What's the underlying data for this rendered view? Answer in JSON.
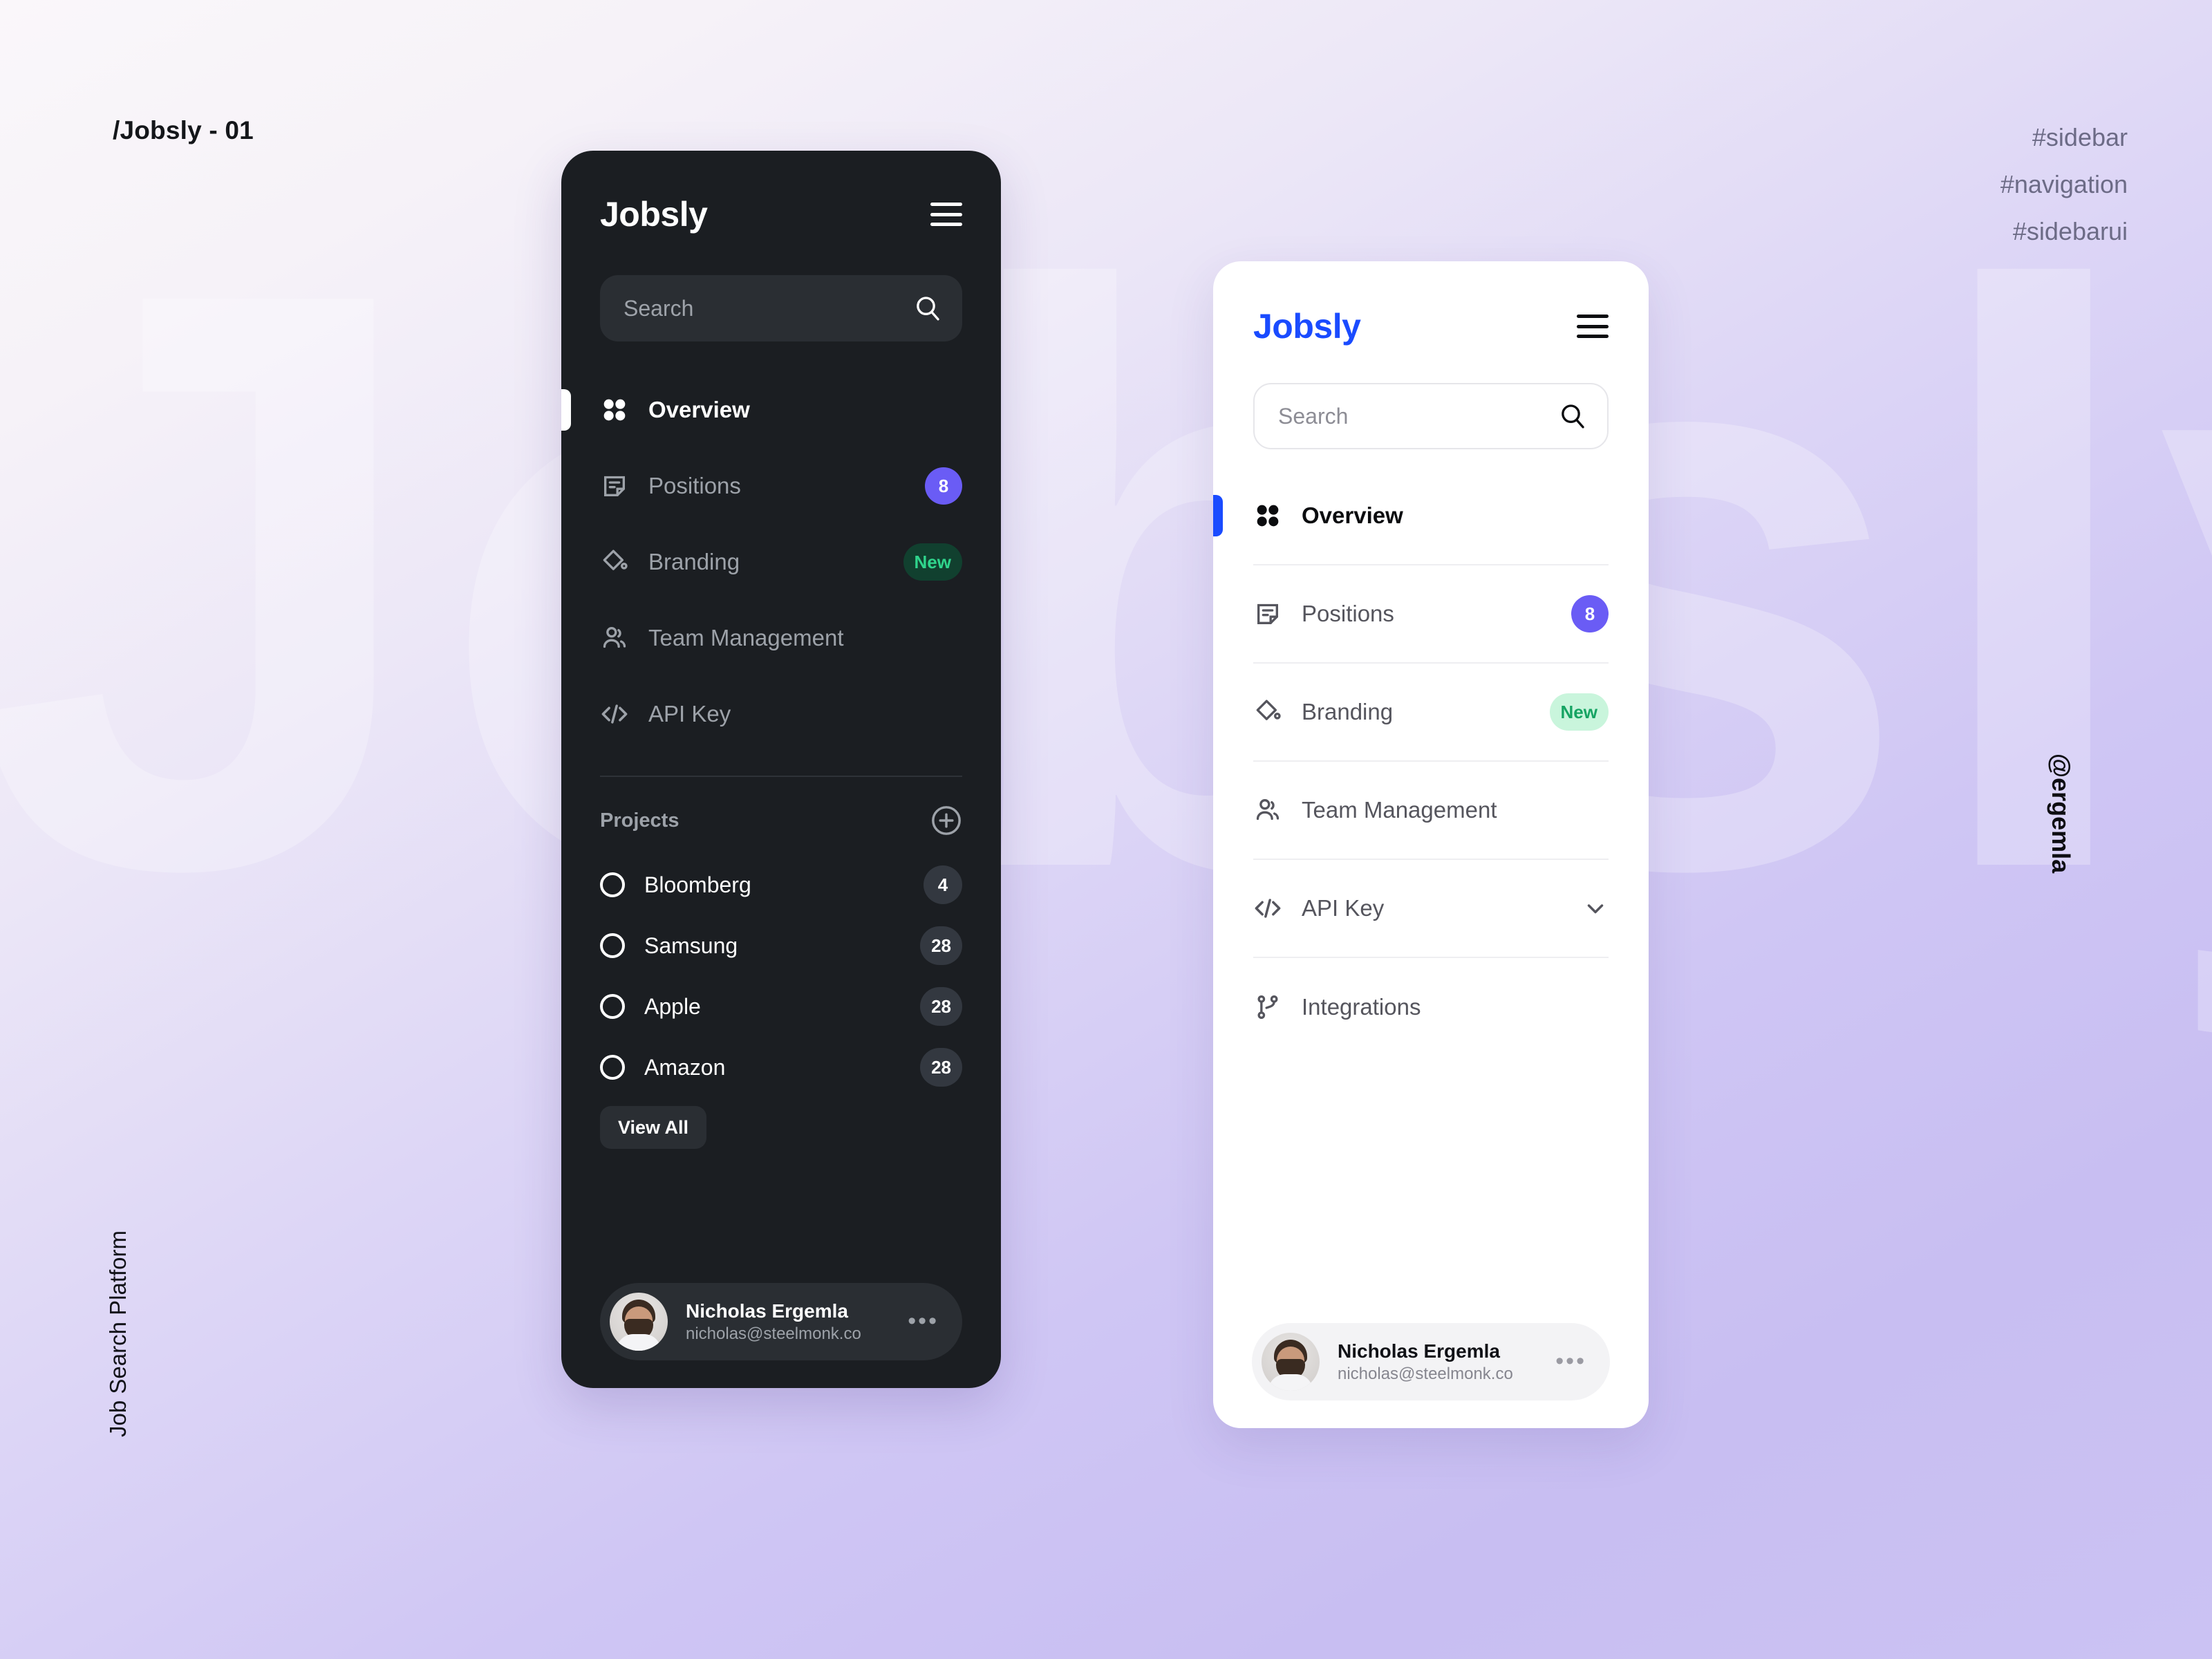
{
  "page": {
    "title": "/Jobsly - 01",
    "tags": [
      "#sidebar",
      "#navigation",
      "#sidebarui"
    ],
    "left_label": "Job Search Platform",
    "right_label": "@ergemla",
    "watermark": "Jobsly",
    "colors": {
      "brand_blue": "#1A4BFF",
      "badge_purple": "#6A5CF5",
      "badge_new_dark_bg": "#11402F",
      "badge_new_dark_text": "#2FD48C",
      "badge_new_light_bg": "#C9F5DC",
      "badge_new_light_text": "#16A463",
      "dark_panel_bg": "#1B1E22",
      "light_panel_bg": "#FFFFFF"
    }
  },
  "dark_sidebar": {
    "brand": "Jobsly",
    "menu_icon": "hamburger-icon",
    "search": {
      "placeholder": "Search",
      "icon": "search-icon"
    },
    "nav": [
      {
        "label": "Overview",
        "icon": "grid-icon",
        "active": true,
        "badge": null,
        "badge_type": null
      },
      {
        "label": "Positions",
        "icon": "note-icon",
        "active": false,
        "badge": "8",
        "badge_type": "count"
      },
      {
        "label": "Branding",
        "icon": "paint-icon",
        "active": false,
        "badge": "New",
        "badge_type": "new"
      },
      {
        "label": "Team Management",
        "icon": "users-icon",
        "active": false,
        "badge": null,
        "badge_type": null
      },
      {
        "label": "API Key",
        "icon": "code-icon",
        "active": false,
        "badge": null,
        "badge_type": null
      }
    ],
    "projects": {
      "title": "Projects",
      "add_icon": "plus-circle-icon",
      "items": [
        {
          "label": "Bloomberg",
          "count": "4"
        },
        {
          "label": "Samsung",
          "count": "28"
        },
        {
          "label": "Apple",
          "count": "28"
        },
        {
          "label": "Amazon",
          "count": "28"
        }
      ],
      "view_all_label": "View All"
    },
    "profile": {
      "name": "Nicholas Ergemla",
      "email": "nicholas@steelmonk.co",
      "more_icon": "ellipsis-icon",
      "avatar": "avatar"
    }
  },
  "light_sidebar": {
    "brand": "Jobsly",
    "menu_icon": "hamburger-icon",
    "search": {
      "placeholder": "Search",
      "icon": "search-icon"
    },
    "nav": [
      {
        "label": "Overview",
        "icon": "grid-icon",
        "active": true,
        "badge": null,
        "badge_type": null,
        "chevron": false
      },
      {
        "label": "Positions",
        "icon": "note-icon",
        "active": false,
        "badge": "8",
        "badge_type": "count",
        "chevron": false
      },
      {
        "label": "Branding",
        "icon": "paint-icon",
        "active": false,
        "badge": "New",
        "badge_type": "new",
        "chevron": false
      },
      {
        "label": "Team Management",
        "icon": "users-icon",
        "active": false,
        "badge": null,
        "badge_type": null,
        "chevron": false
      },
      {
        "label": "API Key",
        "icon": "code-icon",
        "active": false,
        "badge": null,
        "badge_type": null,
        "chevron": true
      },
      {
        "label": "Integrations",
        "icon": "branch-icon",
        "active": false,
        "badge": null,
        "badge_type": null,
        "chevron": false
      }
    ],
    "profile": {
      "name": "Nicholas Ergemla",
      "email": "nicholas@steelmonk.co",
      "more_icon": "ellipsis-icon",
      "avatar": "avatar"
    }
  }
}
